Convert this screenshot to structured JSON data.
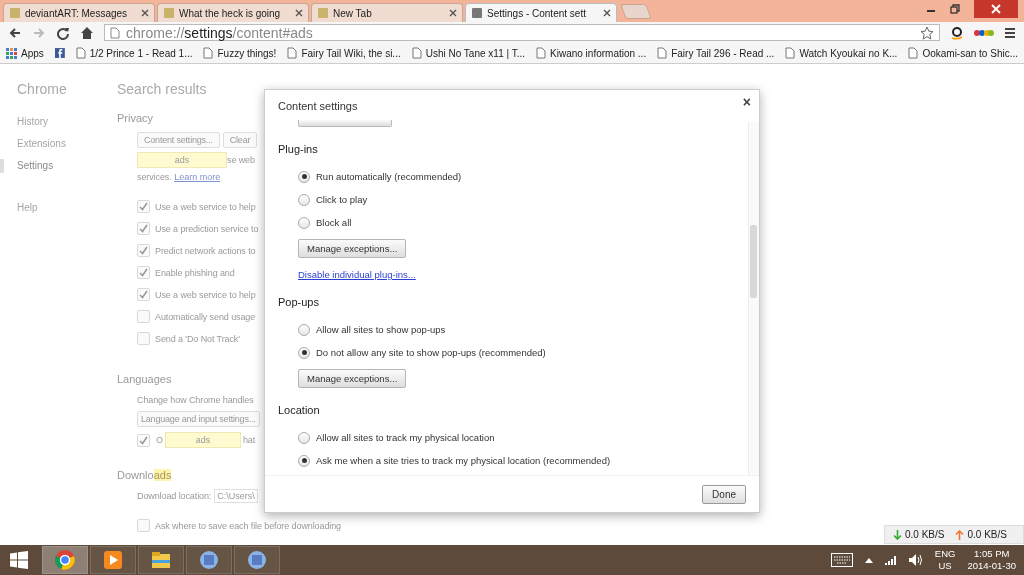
{
  "tabs": [
    {
      "title": "deviantART: Messages",
      "selected": false
    },
    {
      "title": "What the heck is going",
      "selected": false
    },
    {
      "title": "New Tab",
      "selected": false
    },
    {
      "title": "Settings - Content sett",
      "selected": true
    }
  ],
  "address": {
    "scheme": "chrome://",
    "host": "settings",
    "path": "/content#ads"
  },
  "bookmarks": {
    "apps": "Apps",
    "items": [
      {
        "label": "1/2 Prince 1 - Read 1..."
      },
      {
        "label": "Fuzzy things!"
      },
      {
        "label": "Fairy Tail Wiki, the si..."
      },
      {
        "label": "Ushi No Tane x11 | T..."
      },
      {
        "label": "Kiwano information ..."
      },
      {
        "label": "Fairy Tail 296 - Read ..."
      },
      {
        "label": "Watch Kyoukai no K..."
      },
      {
        "label": "Ookami-san to Shic..."
      }
    ]
  },
  "sidebar": {
    "title": "Chrome",
    "groups": [
      [
        {
          "label": "History",
          "selected": false
        },
        {
          "label": "Extensions",
          "selected": false
        },
        {
          "label": "Settings",
          "selected": true
        }
      ],
      [
        {
          "label": "Help",
          "selected": false
        }
      ]
    ]
  },
  "settings": {
    "heading": "Search results",
    "privacy": {
      "title": "Privacy",
      "buttons": [
        "Content settings...",
        "Clear"
      ],
      "tooltip": "ads",
      "description_tail": "se web",
      "description_line": "services.",
      "link": "Learn more",
      "checkboxes": [
        {
          "label": "Use a web service to help",
          "checked": true
        },
        {
          "label": "Use a prediction service to",
          "checked": true
        },
        {
          "label": "Predict network actions to",
          "checked": true
        },
        {
          "label": "Enable phishing and",
          "checked": true
        },
        {
          "label": "Use a web service to help",
          "checked": true
        },
        {
          "label": "Automatically send usage",
          "checked": false
        },
        {
          "label": "Send a 'Do Not Track'",
          "checked": false
        }
      ]
    },
    "languages": {
      "title": "Languages",
      "description": "Change how Chrome handles",
      "button": "Language and input settings...",
      "tooltip": "ads",
      "checkbox": {
        "label_start": "O",
        "label_end": "hat",
        "checked": true
      }
    },
    "downloads": {
      "title": "Downlo",
      "title_highlight": "ads",
      "location_label": "Download location:",
      "location_value": "C:\\Users\\",
      "checkbox": {
        "label": "Ask where to save each file before downloading",
        "checked": false
      }
    }
  },
  "dialog": {
    "title": "Content settings",
    "close": "×",
    "sections": [
      {
        "title": "Plug-ins",
        "options": [
          {
            "label": "Run automatically (recommended)",
            "selected": true
          },
          {
            "label": "Click to play",
            "selected": false
          },
          {
            "label": "Block all",
            "selected": false
          }
        ],
        "button": "Manage exceptions...",
        "link": "Disable individual plug-ins..."
      },
      {
        "title": "Pop-ups",
        "options": [
          {
            "label": "Allow all sites to show pop-ups",
            "selected": false
          },
          {
            "label": "Do not allow any site to show pop-ups (recommended)",
            "selected": true
          }
        ],
        "button": "Manage exceptions..."
      },
      {
        "title": "Location",
        "options": [
          {
            "label": "Allow all sites to track my physical location",
            "selected": false
          },
          {
            "label": "Ask me when a site tries to track my physical location (recommended)",
            "selected": true
          }
        ]
      }
    ],
    "done": "Done"
  },
  "net_meter": {
    "download": "0.0 KB/S",
    "upload": "0.0 KB/S"
  },
  "taskbar": {
    "apps": [
      {
        "selected": true
      },
      {
        "selected": false
      },
      {
        "selected": false
      },
      {
        "selected": false
      },
      {
        "selected": false
      }
    ],
    "language": "ENG",
    "region": "US",
    "time": "1:05 PM",
    "date": "2014-01-30"
  }
}
